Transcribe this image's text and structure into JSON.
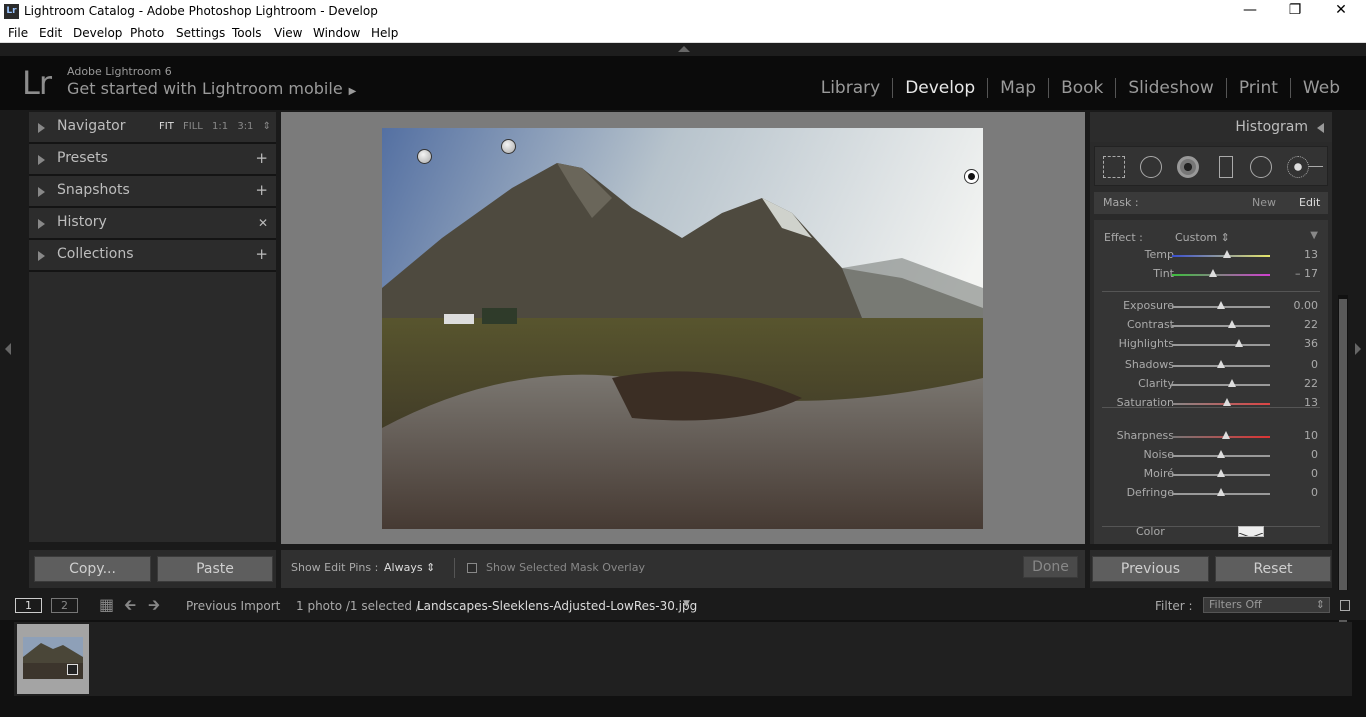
{
  "window": {
    "title": "Lightroom Catalog - Adobe Photoshop Lightroom - Develop",
    "app_icon": "Lr"
  },
  "menu": [
    "File",
    "Edit",
    "Develop",
    "Photo",
    "Settings",
    "Tools",
    "View",
    "Window",
    "Help"
  ],
  "identity": {
    "logo": "Lr",
    "version": "Adobe Lightroom 6",
    "mobile_text": "Get started with Lightroom mobile"
  },
  "modules": [
    "Library",
    "Develop",
    "Map",
    "Book",
    "Slideshow",
    "Print",
    "Web"
  ],
  "active_module": "Develop",
  "left_panel": {
    "navigator": {
      "label": "Navigator",
      "options": [
        "FIT",
        "FILL",
        "1:1",
        "3:1"
      ]
    },
    "presets": "Presets",
    "snapshots": "Snapshots",
    "history": "History",
    "collections": "Collections",
    "copy_label": "Copy...",
    "paste_label": "Paste"
  },
  "toolbar": {
    "show_pins_label": "Show Edit Pins :",
    "show_pins_value": "Always",
    "overlay_label": "Show Selected Mask Overlay",
    "done_label": "Done"
  },
  "right_panel": {
    "histogram": "Histogram",
    "mask": {
      "label": "Mask :",
      "new": "New",
      "edit": "Edit"
    },
    "effect": {
      "label": "Effect :",
      "value": "Custom"
    },
    "sliders": [
      {
        "name": "Temp",
        "value": "13",
        "pos": 0.565
      },
      {
        "name": "Tint",
        "value": "– 17",
        "pos": 0.415
      },
      {
        "name": "Exposure",
        "value": "0.00",
        "pos": 0.5
      },
      {
        "name": "Contrast",
        "value": "22",
        "pos": 0.61
      },
      {
        "name": "Highlights",
        "value": "36",
        "pos": 0.68
      },
      {
        "name": "Shadows",
        "value": "0",
        "pos": 0.5
      },
      {
        "name": "Clarity",
        "value": "22",
        "pos": 0.61
      },
      {
        "name": "Saturation",
        "value": "13",
        "pos": 0.565
      },
      {
        "name": "Sharpness",
        "value": "10",
        "pos": 0.55
      },
      {
        "name": "Noise",
        "value": "0",
        "pos": 0.5
      },
      {
        "name": "Moiré",
        "value": "0",
        "pos": 0.5
      },
      {
        "name": "Defringe",
        "value": "0",
        "pos": 0.5
      }
    ],
    "color_label": "Color",
    "previous_label": "Previous",
    "reset_label": "Reset"
  },
  "filmstrip": {
    "page1": "1",
    "page2": "2",
    "source": "Previous Import",
    "count": "1 photo /1 selected /",
    "filename": "Landscapes-Sleeklens-Adjusted-LowRes-30.jpg",
    "filter_label": "Filter :",
    "filter_value": "Filters Off"
  }
}
